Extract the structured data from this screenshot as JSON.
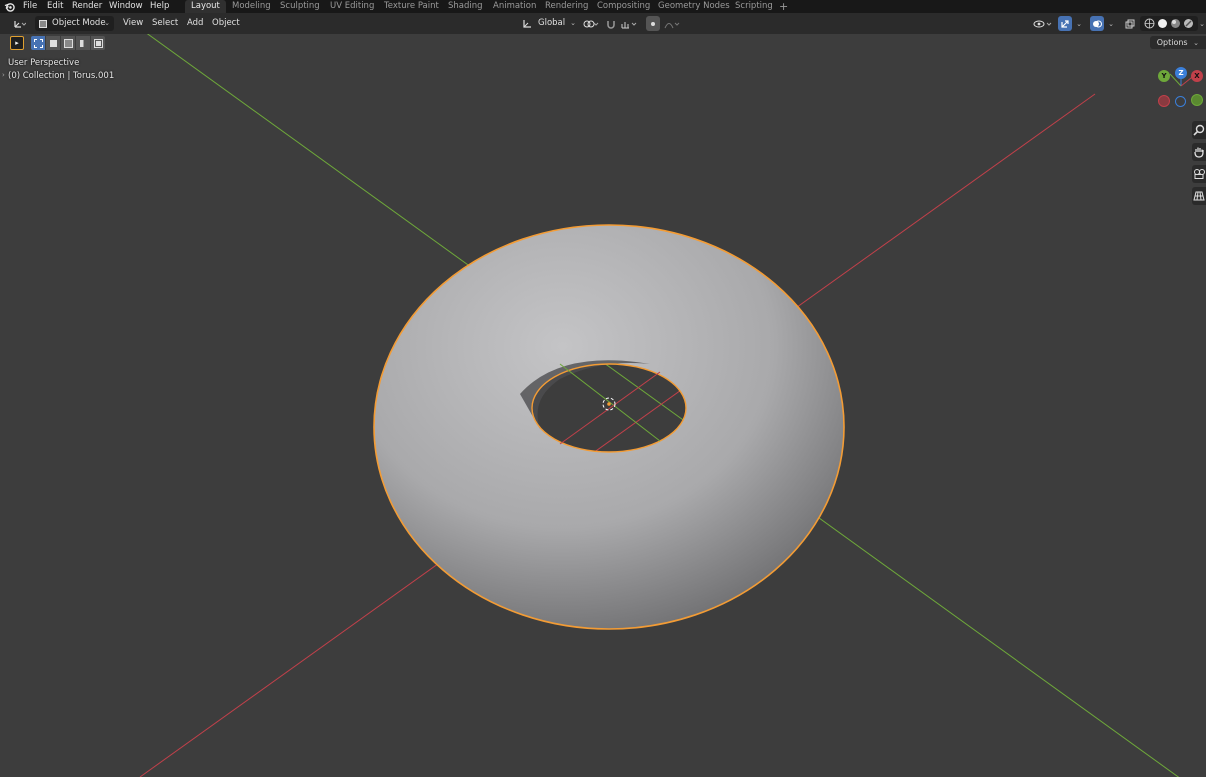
{
  "menu": {
    "file": "File",
    "edit": "Edit",
    "render": "Render",
    "window": "Window",
    "help": "Help"
  },
  "workspaces": [
    "Layout",
    "Modeling",
    "Sculpting",
    "UV Editing",
    "Texture Paint",
    "Shading",
    "Animation",
    "Rendering",
    "Compositing",
    "Geometry Nodes",
    "Scripting"
  ],
  "workspace_add": "+",
  "header": {
    "mode": "Object Mode",
    "view": "View",
    "select": "Select",
    "add": "Add",
    "object": "Object",
    "orientation": "Global"
  },
  "viewport": {
    "perspective_label": "User Perspective",
    "collection_label": "(0) Collection | Torus.001",
    "options_label": "Options"
  },
  "gizmo": {
    "y": "Y",
    "z": "Z",
    "x": "X"
  },
  "colors": {
    "x_axis": "#c0404a",
    "y_axis": "#6ea83a",
    "z_axis": "#3b7fd9",
    "selection_outline": "#f39c35",
    "background": "#3d3d3d",
    "accent_blue": "#4772b3"
  }
}
